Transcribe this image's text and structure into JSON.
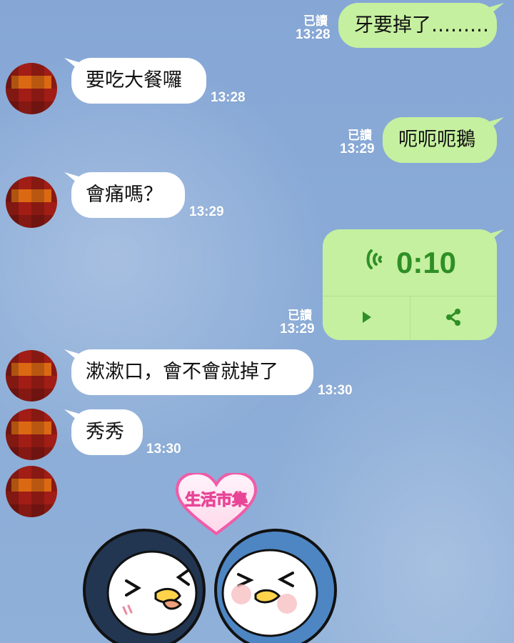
{
  "messages": [
    {
      "side": "right",
      "text": "牙要掉了………",
      "time": "13:28",
      "read": "已讀"
    },
    {
      "side": "left",
      "text": "要吃大餐囉",
      "time": "13:28"
    },
    {
      "side": "right",
      "text": "呃呃呃鵝",
      "time": "13:29",
      "read": "已讀"
    },
    {
      "side": "left",
      "text": "會痛嗎？",
      "time": "13:29"
    },
    {
      "side": "left",
      "text": "漱漱口，會不會就掉了",
      "time": "13:30"
    },
    {
      "side": "left",
      "text": "秀秀",
      "time": "13:30"
    }
  ],
  "voice_message": {
    "duration": "0:10",
    "time": "13:29",
    "read": "已讀",
    "icon": "sound-wave-icon",
    "actions": [
      {
        "name": "play-icon"
      },
      {
        "name": "share-icon"
      }
    ]
  },
  "sticker": {
    "label": "生活市集",
    "theme": "penguins"
  },
  "colors": {
    "background": "#8aa8d2",
    "incoming_bubble": "#ffffff",
    "outgoing_bubble": "#c5f09f",
    "accent_green": "#2f8f26",
    "avatar_red": "#a11d16",
    "avatar_orange": "#ff7a16"
  }
}
